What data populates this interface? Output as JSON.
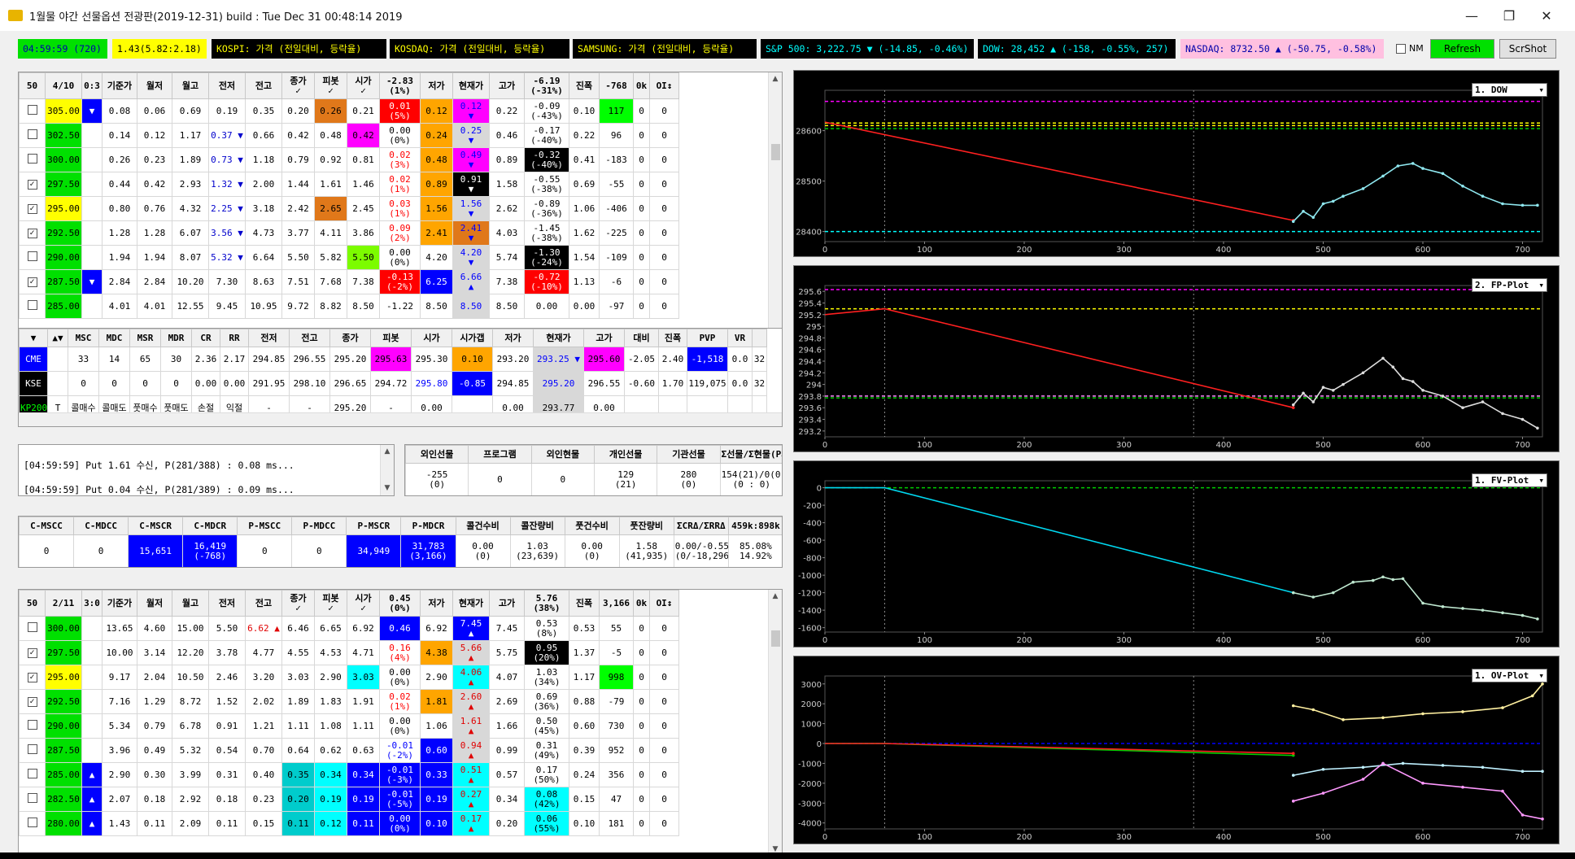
{
  "window": {
    "title": "1월물 야간 선물옵션 전광판(2019-12-31) build : Tue Dec 31 00:48:14 2019",
    "minimize": "—",
    "maximize": "❐",
    "close": "✕"
  },
  "toolbar": {
    "time": "04:59:59 (720)",
    "ratio": "1.43(5.82:2.18)",
    "kospi": "KOSPI: 가격 (전일대비, 등락율)",
    "kosdaq": "KOSDAQ: 가격 (전일대비, 등락율)",
    "samsung": "SAMSUNG: 가격 (전일대비, 등락율)",
    "sp500": "S&P 500: 3,222.75 ▼ (-14.85, -0.46%)",
    "dow": "DOW: 28,452 ▲ (-158, -0.55%, 257)",
    "nasdaq": "NASDAQ: 8732.50 ▲ (-50.75, -0.58%)",
    "nm_label": "NM",
    "refresh": "Refresh",
    "scrshot": "ScrShot"
  },
  "call_table": {
    "headers": [
      "50",
      "4/10",
      "0:3",
      "기준가",
      "월저",
      "월고",
      "전저",
      "전고",
      "종가\n✓",
      "피봇\n✓",
      "시가\n✓",
      "-2.83\n(1%)",
      "저가",
      "현재가",
      "고가",
      "-6.19\n(-31%)",
      "진폭",
      "-768",
      "0k",
      "OI↕"
    ],
    "rows": [
      [
        "305.00",
        "▼",
        "0.08",
        "0.06",
        "0.69",
        "0.19",
        "0.35",
        "0.20",
        "0.26",
        "0.21",
        "0.01\n(5%)",
        "0.12",
        "0.12\n▼",
        "0.22",
        "-0.09\n(-43%)",
        "0.10",
        "117",
        "0",
        "0"
      ],
      [
        "302.50",
        "",
        "0.14",
        "0.12",
        "1.17",
        "0.37 ▼",
        "0.66",
        "0.42",
        "0.48",
        "0.42",
        "0.00\n(0%)",
        "0.24",
        "0.25\n▼",
        "0.46",
        "-0.17\n(-40%)",
        "0.22",
        "96",
        "0",
        "0"
      ],
      [
        "300.00",
        "",
        "0.26",
        "0.23",
        "1.89",
        "0.73 ▼",
        "1.18",
        "0.79",
        "0.92",
        "0.81",
        "0.02\n(3%)",
        "0.48",
        "0.49\n▼",
        "0.89",
        "-0.32\n(-40%)",
        "0.41",
        "-183",
        "0",
        "0"
      ],
      [
        "297.50",
        "",
        "0.44",
        "0.42",
        "2.93",
        "1.32 ▼",
        "2.00",
        "1.44",
        "1.61",
        "1.46",
        "0.02\n(1%)",
        "0.89",
        "0.91\n▼",
        "1.58",
        "-0.55\n(-38%)",
        "0.69",
        "-55",
        "0",
        "0"
      ],
      [
        "295.00",
        "",
        "0.80",
        "0.76",
        "4.32",
        "2.25 ▼",
        "3.18",
        "2.42",
        "2.65",
        "2.45",
        "0.03\n(1%)",
        "1.56",
        "1.56\n▼",
        "2.62",
        "-0.89\n(-36%)",
        "1.06",
        "-406",
        "0",
        "0"
      ],
      [
        "292.50",
        "",
        "1.28",
        "1.28",
        "6.07",
        "3.56 ▼",
        "4.73",
        "3.77",
        "4.11",
        "3.86",
        "0.09\n(2%)",
        "2.41",
        "2.41\n▼",
        "4.03",
        "-1.45\n(-38%)",
        "1.62",
        "-225",
        "0",
        "0"
      ],
      [
        "290.00",
        "",
        "1.94",
        "1.94",
        "8.07",
        "5.32 ▼",
        "6.64",
        "5.50",
        "5.82",
        "5.50",
        "0.00\n(0%)",
        "4.20",
        "4.20\n▼",
        "5.74",
        "-1.30\n(-24%)",
        "1.54",
        "-109",
        "0",
        "0"
      ],
      [
        "287.50",
        "▼",
        "2.84",
        "2.84",
        "10.20",
        "7.30",
        "8.63",
        "7.51",
        "7.68",
        "7.38",
        "-0.13\n(-2%)",
        "6.25",
        "6.66\n▲",
        "7.38",
        "-0.72\n(-10%)",
        "1.13",
        "-6",
        "0",
        "0"
      ],
      [
        "285.00",
        "",
        "4.01",
        "4.01",
        "12.55",
        "9.45",
        "10.95",
        "9.72",
        "8.82",
        "8.50",
        "-1.22",
        "8.50",
        "8.50",
        "8.50",
        "0.00",
        "0.00",
        "-97",
        "0",
        "0"
      ]
    ],
    "checked": [
      false,
      false,
      false,
      true,
      true,
      true,
      false,
      true,
      false
    ]
  },
  "futures_table": {
    "headers": [
      "▼",
      "▲▼",
      "MSC",
      "MDC",
      "MSR",
      "MDR",
      "CR",
      "RR",
      "전저",
      "전고",
      "종가",
      "피봇",
      "시가",
      "시가갭",
      "저가",
      "현재가",
      "고가",
      "대비",
      "진폭",
      "PVP",
      "VR"
    ],
    "rows": [
      [
        "CME",
        "",
        "33",
        "14",
        "65",
        "30",
        "2.36",
        "2.17",
        "294.85",
        "296.55",
        "295.20",
        "295.63",
        "295.30",
        "0.10",
        "293.20",
        "293.25 ▼",
        "295.60",
        "-2.05",
        "2.40",
        "-1,518",
        "0.0",
        "32"
      ],
      [
        "KSE",
        "",
        "0",
        "0",
        "0",
        "0",
        "0.00",
        "0.00",
        "291.95",
        "298.10",
        "296.65",
        "294.72",
        "295.80",
        "-0.85",
        "294.85",
        "295.20",
        "296.55",
        "-0.60",
        "1.70",
        "119,075",
        "0.0",
        "32"
      ],
      [
        "KP200",
        "T",
        "콜매수",
        "콜매도",
        "풋매수",
        "풋매도",
        "손절",
        "익절",
        "-",
        "-",
        "295.20",
        "-",
        "0.00",
        "",
        "0.00",
        "293.77",
        "0.00",
        "",
        "",
        "",
        "",
        ""
      ]
    ]
  },
  "log": {
    "lines": [
      "[04:59:59] Put 1.61 수신, P(281/388) : 0.08 ms...",
      "[04:59:59] Put 0.04 수신, P(281/389) : 0.09 ms..."
    ]
  },
  "investor_table": {
    "headers": [
      "외인선물",
      "프로그램",
      "외인현물",
      "개인선물",
      "기관선물",
      "Σ선물/Σ현물(P시가갭)"
    ],
    "values": [
      "-255\n(0)",
      "0",
      "0",
      "129\n(21)",
      "280\n(0)",
      "154(21)/0(0)\n(0 : 0)"
    ]
  },
  "ratio_table": {
    "headers": [
      "C-MSCC",
      "C-MDCC",
      "C-MSCR",
      "C-MDCR",
      "P-MSCC",
      "P-MDCC",
      "P-MSCR",
      "P-MDCR",
      "콜건수비",
      "콜잔량비",
      "풋건수비",
      "풋잔량비",
      "ΣCRΔ/ΣRRΔ",
      "459k:898k"
    ],
    "values": [
      "0",
      "0",
      "15,651",
      "16,419\n(-768)",
      "0",
      "0",
      "34,949",
      "31,783\n(3,166)",
      "0.00\n(0)",
      "1.03\n(23,639)",
      "0.00\n(0)",
      "1.58\n(41,935)",
      "0.00/-0.55\n(0/-18,296)",
      "85.08%\n14.92%"
    ]
  },
  "put_table": {
    "headers": [
      "50",
      "2/11",
      "3:0",
      "기준가",
      "월저",
      "월고",
      "전저",
      "전고",
      "종가\n✓",
      "피봇\n✓",
      "시가\n✓",
      "0.45\n(0%)",
      "저가",
      "현재가",
      "고가",
      "5.76\n(38%)",
      "진폭",
      "3,166",
      "0k",
      "OI↕"
    ],
    "rows": [
      [
        "300.00",
        "",
        "13.65",
        "4.60",
        "15.00",
        "5.50",
        "6.62 ▲",
        "6.46",
        "6.65",
        "6.92",
        "0.46",
        "6.92",
        "7.45\n▲",
        "7.45",
        "0.53\n(8%)",
        "0.53",
        "55",
        "0",
        "0"
      ],
      [
        "297.50",
        "",
        "10.00",
        "3.14",
        "12.20",
        "3.78",
        "4.77",
        "4.55",
        "4.53",
        "4.71",
        "0.16\n(4%)",
        "4.38",
        "5.66\n▲",
        "5.75",
        "0.95\n(20%)",
        "1.37",
        "-5",
        "0",
        "0"
      ],
      [
        "295.00",
        "",
        "9.17",
        "2.04",
        "10.50",
        "2.46",
        "3.20",
        "3.03",
        "2.90",
        "3.03",
        "0.00\n(0%)",
        "2.90",
        "4.06\n▲",
        "4.07",
        "1.03\n(34%)",
        "1.17",
        "998",
        "0",
        "0"
      ],
      [
        "292.50",
        "",
        "7.16",
        "1.29",
        "8.72",
        "1.52",
        "2.02",
        "1.89",
        "1.83",
        "1.91",
        "0.02\n(1%)",
        "1.81",
        "2.60\n▲",
        "2.69",
        "0.69\n(36%)",
        "0.88",
        "-79",
        "0",
        "0"
      ],
      [
        "290.00",
        "",
        "5.34",
        "0.79",
        "6.78",
        "0.91",
        "1.21",
        "1.11",
        "1.08",
        "1.11",
        "0.00\n(0%)",
        "1.06",
        "1.61\n▲",
        "1.66",
        "0.50\n(45%)",
        "0.60",
        "730",
        "0",
        "0"
      ],
      [
        "287.50",
        "",
        "3.96",
        "0.49",
        "5.32",
        "0.54",
        "0.70",
        "0.64",
        "0.62",
        "0.63",
        "-0.01\n(-2%)",
        "0.60",
        "0.94\n▲",
        "0.99",
        "0.31\n(49%)",
        "0.39",
        "952",
        "0",
        "0"
      ],
      [
        "285.00",
        "▲",
        "2.90",
        "0.30",
        "3.99",
        "0.31",
        "0.40",
        "0.35",
        "0.34",
        "0.34",
        "-0.01\n(-3%)",
        "0.33",
        "0.51\n▲",
        "0.57",
        "0.17\n(50%)",
        "0.24",
        "356",
        "0",
        "0"
      ],
      [
        "282.50",
        "▲",
        "2.07",
        "0.18",
        "2.92",
        "0.18",
        "0.23",
        "0.20",
        "0.19",
        "0.19",
        "-0.01\n(-5%)",
        "0.19",
        "0.27\n▲",
        "0.34",
        "0.08\n(42%)",
        "0.15",
        "47",
        "0",
        "0"
      ],
      [
        "280.00",
        "▲",
        "1.43",
        "0.11",
        "2.09",
        "0.11",
        "0.15",
        "0.11",
        "0.12",
        "0.11",
        "0.00\n(0%)",
        "0.10",
        "0.17\n▲",
        "0.20",
        "0.06\n(55%)",
        "0.10",
        "181",
        "0",
        "0"
      ]
    ],
    "checked": [
      false,
      true,
      true,
      true,
      false,
      false,
      false,
      false,
      false
    ]
  },
  "chart_data": [
    {
      "type": "line",
      "selector": "1. DOW",
      "x_ticks": [
        "0",
        "100",
        "200",
        "300",
        "400",
        "500",
        "600",
        "700"
      ],
      "y_ticks": [
        "28600",
        "28500",
        "28400"
      ],
      "xlim": [
        0,
        720
      ],
      "ylim": [
        28380,
        28680
      ],
      "hlines": [
        {
          "y": 28658,
          "color": "#ff00ff"
        },
        {
          "y": 28615,
          "color": "#ffff00"
        },
        {
          "y": 28610,
          "color": "#ffff00"
        },
        {
          "y": 28604,
          "color": "#00cc00"
        },
        {
          "y": 28400,
          "color": "#00ffff"
        }
      ],
      "series": [
        {
          "color": "#ff2020",
          "x": [
            0,
            470
          ],
          "y": [
            28617,
            28422
          ]
        },
        {
          "color": "#8fe8f0",
          "x": [
            470,
            480,
            490,
            500,
            510,
            520,
            540,
            560,
            575,
            590,
            600,
            620,
            640,
            660,
            680,
            700,
            715
          ],
          "y": [
            28420,
            28440,
            28428,
            28455,
            28460,
            28470,
            28485,
            28510,
            28530,
            28535,
            28525,
            28515,
            28490,
            28470,
            28455,
            28452,
            28452
          ]
        }
      ]
    },
    {
      "type": "line",
      "selector": "2. FP-Plot",
      "x_ticks": [
        "0",
        "100",
        "200",
        "300",
        "400",
        "500",
        "600",
        "700"
      ],
      "y_ticks": [
        "295.6",
        "295.4",
        "295.2",
        "295",
        "294.8",
        "294.6",
        "294.4",
        "294.2",
        "294",
        "293.8",
        "293.6",
        "293.4",
        "293.2"
      ],
      "xlim": [
        0,
        720
      ],
      "ylim": [
        293.1,
        295.7
      ],
      "hlines": [
        {
          "y": 295.63,
          "color": "#ff00ff"
        },
        {
          "y": 295.3,
          "color": "#ffff00"
        },
        {
          "y": 293.77,
          "color": "#00cc00"
        },
        {
          "y": 293.8,
          "color": "#ff88ff"
        }
      ],
      "series": [
        {
          "color": "#ff2020",
          "x": [
            0,
            60,
            470
          ],
          "y": [
            295.2,
            295.3,
            293.6
          ]
        },
        {
          "color": "#dddddd",
          "x": [
            470,
            480,
            490,
            500,
            510,
            520,
            540,
            560,
            570,
            580,
            590,
            600,
            620,
            640,
            660,
            680,
            700,
            715
          ],
          "y": [
            293.65,
            293.85,
            293.7,
            293.95,
            293.9,
            294.0,
            294.2,
            294.45,
            294.3,
            294.1,
            294.05,
            293.9,
            293.8,
            293.6,
            293.7,
            293.5,
            293.4,
            293.25
          ]
        }
      ]
    },
    {
      "type": "line",
      "selector": "1. FV-Plot",
      "x_ticks": [
        "0",
        "100",
        "200",
        "300",
        "400",
        "500",
        "600",
        "700"
      ],
      "y_ticks": [
        "0",
        "-200",
        "-400",
        "-600",
        "-800",
        "-1000",
        "-1200",
        "-1400",
        "-1600"
      ],
      "xlim": [
        0,
        720
      ],
      "ylim": [
        -1650,
        80
      ],
      "hlines": [
        {
          "y": 0,
          "color": "#00cc00"
        }
      ],
      "series": [
        {
          "color": "#00d8f0",
          "x": [
            0,
            60,
            470
          ],
          "y": [
            0,
            0,
            -1200
          ]
        },
        {
          "color": "#bfe8d0",
          "x": [
            470,
            490,
            510,
            530,
            550,
            560,
            570,
            580,
            600,
            620,
            640,
            660,
            680,
            700,
            715
          ],
          "y": [
            -1200,
            -1250,
            -1200,
            -1080,
            -1060,
            -1020,
            -1050,
            -1040,
            -1320,
            -1360,
            -1380,
            -1400,
            -1430,
            -1460,
            -1500
          ]
        }
      ]
    },
    {
      "type": "line",
      "selector": "1. OV-Plot",
      "x_ticks": [
        "0",
        "100",
        "200",
        "300",
        "400",
        "500",
        "600",
        "700"
      ],
      "y_ticks": [
        "3000",
        "2000",
        "1000",
        "0",
        "-1000",
        "-2000",
        "-3000",
        "-4000"
      ],
      "xlim": [
        0,
        720
      ],
      "ylim": [
        -4300,
        3400
      ],
      "hlines": [
        {
          "y": 0,
          "color": "#0000ff"
        }
      ],
      "series": [
        {
          "color": "#00cc00",
          "x": [
            0,
            60,
            470
          ],
          "y": [
            0,
            0,
            -600
          ]
        },
        {
          "color": "#ff2020",
          "x": [
            0,
            60,
            470
          ],
          "y": [
            0,
            0,
            -500
          ]
        },
        {
          "color": "#fff0a0",
          "x": [
            470,
            490,
            520,
            560,
            600,
            640,
            680,
            710,
            720
          ],
          "y": [
            1900,
            1700,
            1200,
            1300,
            1500,
            1600,
            1800,
            2400,
            3000
          ]
        },
        {
          "color": "#bff0ff",
          "x": [
            470,
            500,
            540,
            580,
            620,
            660,
            700,
            720
          ],
          "y": [
            -1600,
            -1300,
            -1200,
            -1000,
            -1100,
            -1200,
            -1400,
            -1400
          ]
        },
        {
          "color": "#ff99ff",
          "x": [
            470,
            500,
            540,
            560,
            600,
            640,
            680,
            700,
            720
          ],
          "y": [
            -2900,
            -2500,
            -1800,
            -1000,
            -2000,
            -2200,
            -2400,
            -3600,
            -3800
          ]
        }
      ]
    }
  ]
}
